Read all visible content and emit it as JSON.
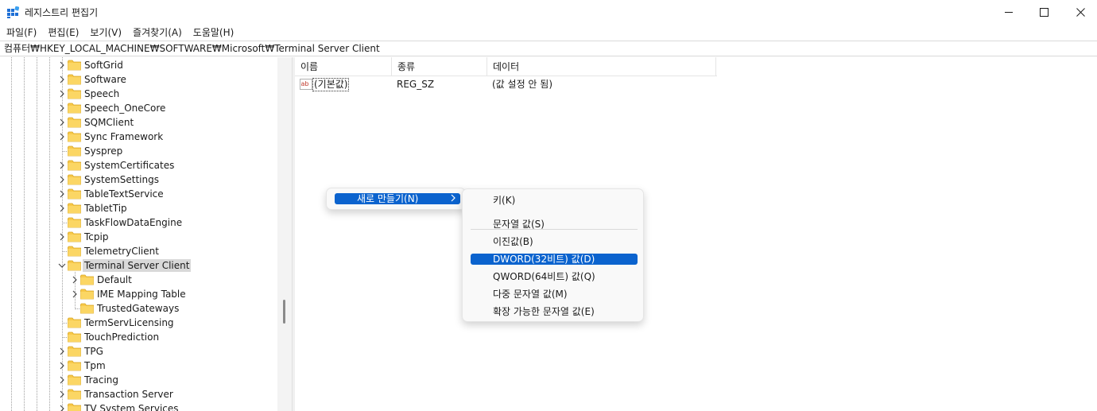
{
  "window": {
    "title": "레지스트리 편집기",
    "minimize_glyph": "—",
    "maximize_glyph": "☐",
    "close_glyph": "✕"
  },
  "menu": [
    "파일(F)",
    "편집(E)",
    "보기(V)",
    "즐겨찾기(A)",
    "도움말(H)"
  ],
  "address": "컴퓨터₩HKEY_LOCAL_MACHINE₩SOFTWARE₩Microsoft₩Terminal Server Client",
  "tree": {
    "items": [
      {
        "label": "SoftGrid",
        "expandable": true,
        "selected": false
      },
      {
        "label": "Software",
        "expandable": true,
        "selected": false
      },
      {
        "label": "Speech",
        "expandable": true,
        "selected": false
      },
      {
        "label": "Speech_OneCore",
        "expandable": true,
        "selected": false
      },
      {
        "label": "SQMClient",
        "expandable": true,
        "selected": false
      },
      {
        "label": "Sync Framework",
        "expandable": true,
        "selected": false
      },
      {
        "label": "Sysprep",
        "expandable": false,
        "selected": false
      },
      {
        "label": "SystemCertificates",
        "expandable": true,
        "selected": false
      },
      {
        "label": "SystemSettings",
        "expandable": true,
        "selected": false
      },
      {
        "label": "TableTextService",
        "expandable": true,
        "selected": false
      },
      {
        "label": "TabletTip",
        "expandable": true,
        "selected": false
      },
      {
        "label": "TaskFlowDataEngine",
        "expandable": false,
        "selected": false
      },
      {
        "label": "Tcpip",
        "expandable": true,
        "selected": false
      },
      {
        "label": "TelemetryClient",
        "expandable": false,
        "selected": false
      },
      {
        "label": "Terminal Server Client",
        "expandable": true,
        "expanded": true,
        "selected": true
      },
      {
        "label": "Default",
        "expandable": true,
        "selected": false,
        "child": true
      },
      {
        "label": "IME Mapping Table",
        "expandable": true,
        "selected": false,
        "child": true
      },
      {
        "label": "TrustedGateways",
        "expandable": false,
        "selected": false,
        "child": true
      },
      {
        "label": "TermServLicensing",
        "expandable": false,
        "selected": false
      },
      {
        "label": "TouchPrediction",
        "expandable": false,
        "selected": false
      },
      {
        "label": "TPG",
        "expandable": true,
        "selected": false
      },
      {
        "label": "Tpm",
        "expandable": true,
        "selected": false
      },
      {
        "label": "Tracing",
        "expandable": true,
        "selected": false
      },
      {
        "label": "Transaction Server",
        "expandable": true,
        "selected": false
      },
      {
        "label": "TV System Services",
        "expandable": true,
        "selected": false
      }
    ]
  },
  "list": {
    "columns": [
      "이름",
      "종류",
      "데이터"
    ],
    "rows": [
      {
        "name": "(기본값)",
        "type": "REG_SZ",
        "data": "(값 설정 안 됨)",
        "icon": "ab-string-icon"
      }
    ]
  },
  "context_menu": {
    "parent_item": "새로 만들기(N)",
    "submenu": [
      {
        "label": "키(K)",
        "highlighted": false
      },
      {
        "separator": true
      },
      {
        "label": "문자열 값(S)",
        "highlighted": false
      },
      {
        "label": "이진값(B)",
        "highlighted": false
      },
      {
        "label": "DWORD(32비트) 값(D)",
        "highlighted": true
      },
      {
        "label": "QWORD(64비트) 값(Q)",
        "highlighted": false
      },
      {
        "label": "다중 문자열 값(M)",
        "highlighted": false
      },
      {
        "label": "확장 가능한 문자열 값(E)",
        "highlighted": false
      }
    ]
  },
  "colors": {
    "accent": "#0b63ce",
    "folder": "#f8c94a",
    "selection": "#d9d9d9"
  }
}
